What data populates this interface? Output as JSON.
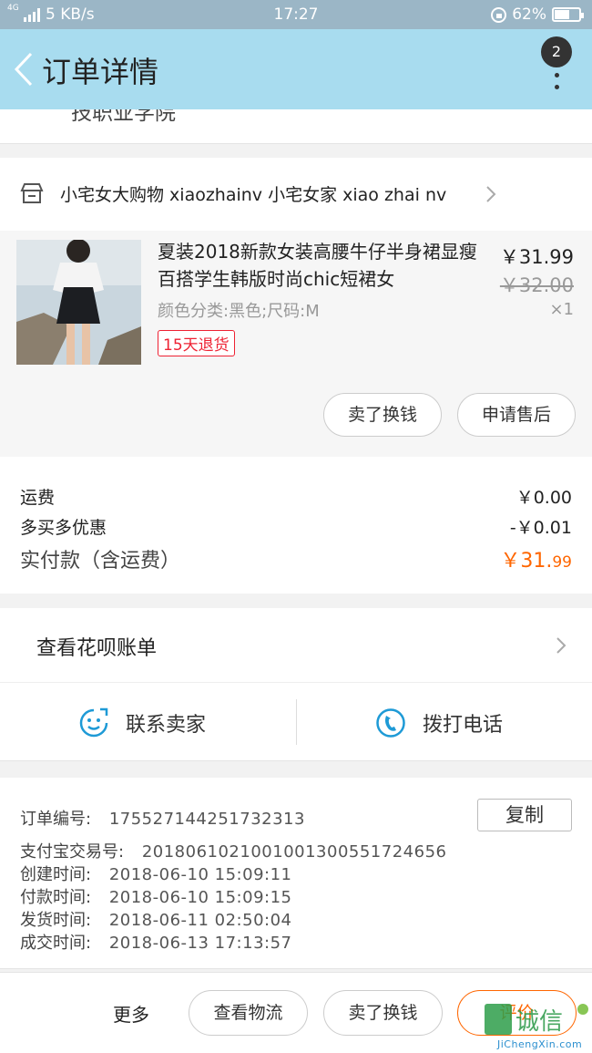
{
  "status_bar": {
    "network": "4G",
    "speed": "5 KB/s",
    "time": "17:27",
    "battery": "62%",
    "battery_level": 0.62
  },
  "nav": {
    "title": "订单详情",
    "badge": "2"
  },
  "address": {
    "text": "技职业学院"
  },
  "store": {
    "name": "小宅女大购物 xiaozhainv 小宅女家 xiao zhai nv"
  },
  "product": {
    "title": "夏装2018新款女装高腰牛仔半身裙显瘦百搭学生韩版时尚chic短裙女",
    "attrs": "颜色分类:黑色;尺码:M",
    "tag": "15天退货",
    "price": "￥31.99",
    "original_price": "￥32.00",
    "quantity": "×1",
    "btn_sell": "卖了换钱",
    "btn_after_sale": "申请售后"
  },
  "fees": {
    "shipping_label": "运费",
    "shipping_value": "￥0.00",
    "discount_label": "多买多优惠",
    "discount_value": "-￥0.01",
    "paid_label": "实付款（含运费）",
    "paid_value_main": "￥31.",
    "paid_value_cents": "99"
  },
  "huabei": {
    "label": "查看花呗账单"
  },
  "contact": {
    "seller": "联系卖家",
    "phone": "拨打电话"
  },
  "order_info": {
    "order_no_label": "订单编号:",
    "order_no": "175527144251732313",
    "copy_label": "复制",
    "alipay_label": "支付宝交易号:",
    "alipay_no": "2018061021001001300551724656",
    "created_label": "创建时间:",
    "created": "2018-06-10 15:09:11",
    "paid_label": "付款时间:",
    "paid": "2018-06-10 15:09:15",
    "shipped_label": "发货时间:",
    "shipped": "2018-06-11 02:50:04",
    "done_label": "成交时间:",
    "done": "2018-06-13 17:13:57"
  },
  "bottom": {
    "more": "更多",
    "logistics": "查看物流",
    "sell": "卖了换钱",
    "review": "评价"
  },
  "watermark": {
    "text": "JiChengXin.com",
    "cn": "集诚信"
  },
  "colors": {
    "nav_bg": "#a8dcef",
    "accent": "#ff6600",
    "tag_red": "#ee2233",
    "icon_blue": "#1e9ad6"
  }
}
